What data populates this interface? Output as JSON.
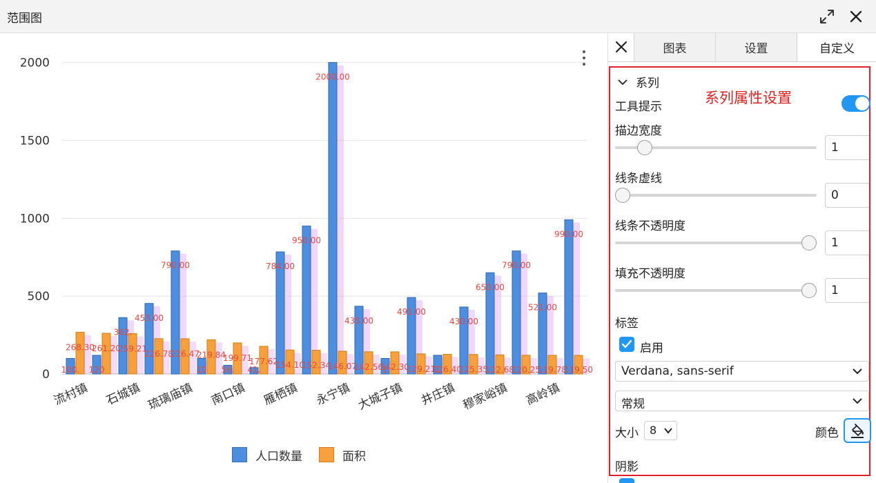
{
  "window": {
    "title": "范围图"
  },
  "chart_data": {
    "type": "bar",
    "categories": [
      "流村镇",
      "石城镇",
      "琉璃庙镇",
      "南口镇",
      "雁栖镇",
      "永宁镇",
      "大城子镇",
      "井庄镇",
      "穆家峪镇",
      "高岭镇"
    ],
    "x_tick_labels_shown": [
      "流村镇",
      "石城镇",
      "琉璃庙镇",
      "南口镇",
      "雁栖镇",
      "永宁镇",
      "大城子镇",
      "井庄镇",
      "穆家峪镇",
      "高岭镇"
    ],
    "series": [
      {
        "name": "人口数量",
        "color": "#4e8ee0",
        "values": [
          100,
          120,
          362,
          453,
          790,
          100,
          56,
          41,
          784,
          950,
          2000,
          435,
          100,
          491,
          120,
          430,
          650,
          790,
          520,
          990
        ],
        "labels": [
          "100.",
          "120",
          "362.",
          "453.00",
          "790.00",
          "10",
          "56.",
          "41.",
          "784.00",
          "950.00",
          "2000.00",
          "435.00",
          "1",
          "491.00",
          "1",
          "430.00",
          "650.00",
          "790.00",
          "521.00",
          "990.00"
        ]
      },
      {
        "name": "面积",
        "color": "#f7a03c",
        "values": [
          268.3,
          261.2,
          259.2,
          226.78,
          226.47,
          219.84,
          199.71,
          177.62,
          154.1,
          152.34,
          146.07,
          142.56,
          142.3,
          129.21,
          126.4,
          125.35,
          122.68,
          120.25,
          119.78,
          119.5
        ],
        "labels": [
          "268.30",
          "261.20",
          "259.21",
          "226.78",
          "226.47",
          "219.84",
          "199.71",
          "177.62",
          "154.10",
          "152.34",
          "146.07",
          "142.56",
          "142.30",
          "129.21",
          "126.40",
          "125.35",
          "122.68",
          "120.25",
          "119.78",
          "119.50"
        ]
      }
    ],
    "yticks": [
      0,
      500,
      1000,
      1500,
      2000
    ],
    "ylim": [
      0,
      2100
    ],
    "grid": true,
    "legend_position": "bottom-center",
    "data_label_color": "#e8473f",
    "bar_shadow_color": "#d88cf0"
  },
  "chart_menu": {
    "icon": "more-vertical-icon"
  },
  "panel": {
    "tabs": [
      {
        "label": "图表"
      },
      {
        "label": "设置"
      },
      {
        "label": "自定义"
      }
    ],
    "section_title": "系列",
    "annotation": "系列属性设置",
    "tooltip_label": "工具提示",
    "tooltip_enabled": true,
    "stroke_width_label": "描边宽度",
    "stroke_width_value": "1",
    "stroke_width_level": 0.12,
    "dash_label": "线条虚线",
    "dash_value": "0",
    "dash_level": 0.0,
    "line_opacity_label": "线条不透明度",
    "line_opacity_value": "1",
    "line_opacity_level": 1.0,
    "fill_opacity_label": "填充不透明度",
    "fill_opacity_value": "1",
    "fill_opacity_level": 1.0,
    "labels_title": "标签",
    "enable_label": "启用",
    "enable_checked": true,
    "font_family_value": "Verdana, sans-serif",
    "font_weight_value": "常规",
    "size_label": "大小",
    "size_value": "8",
    "color_label": "颜色",
    "shadow_label": "阴影",
    "accent": "#2196f3",
    "highlight_border": "#e0202a"
  }
}
